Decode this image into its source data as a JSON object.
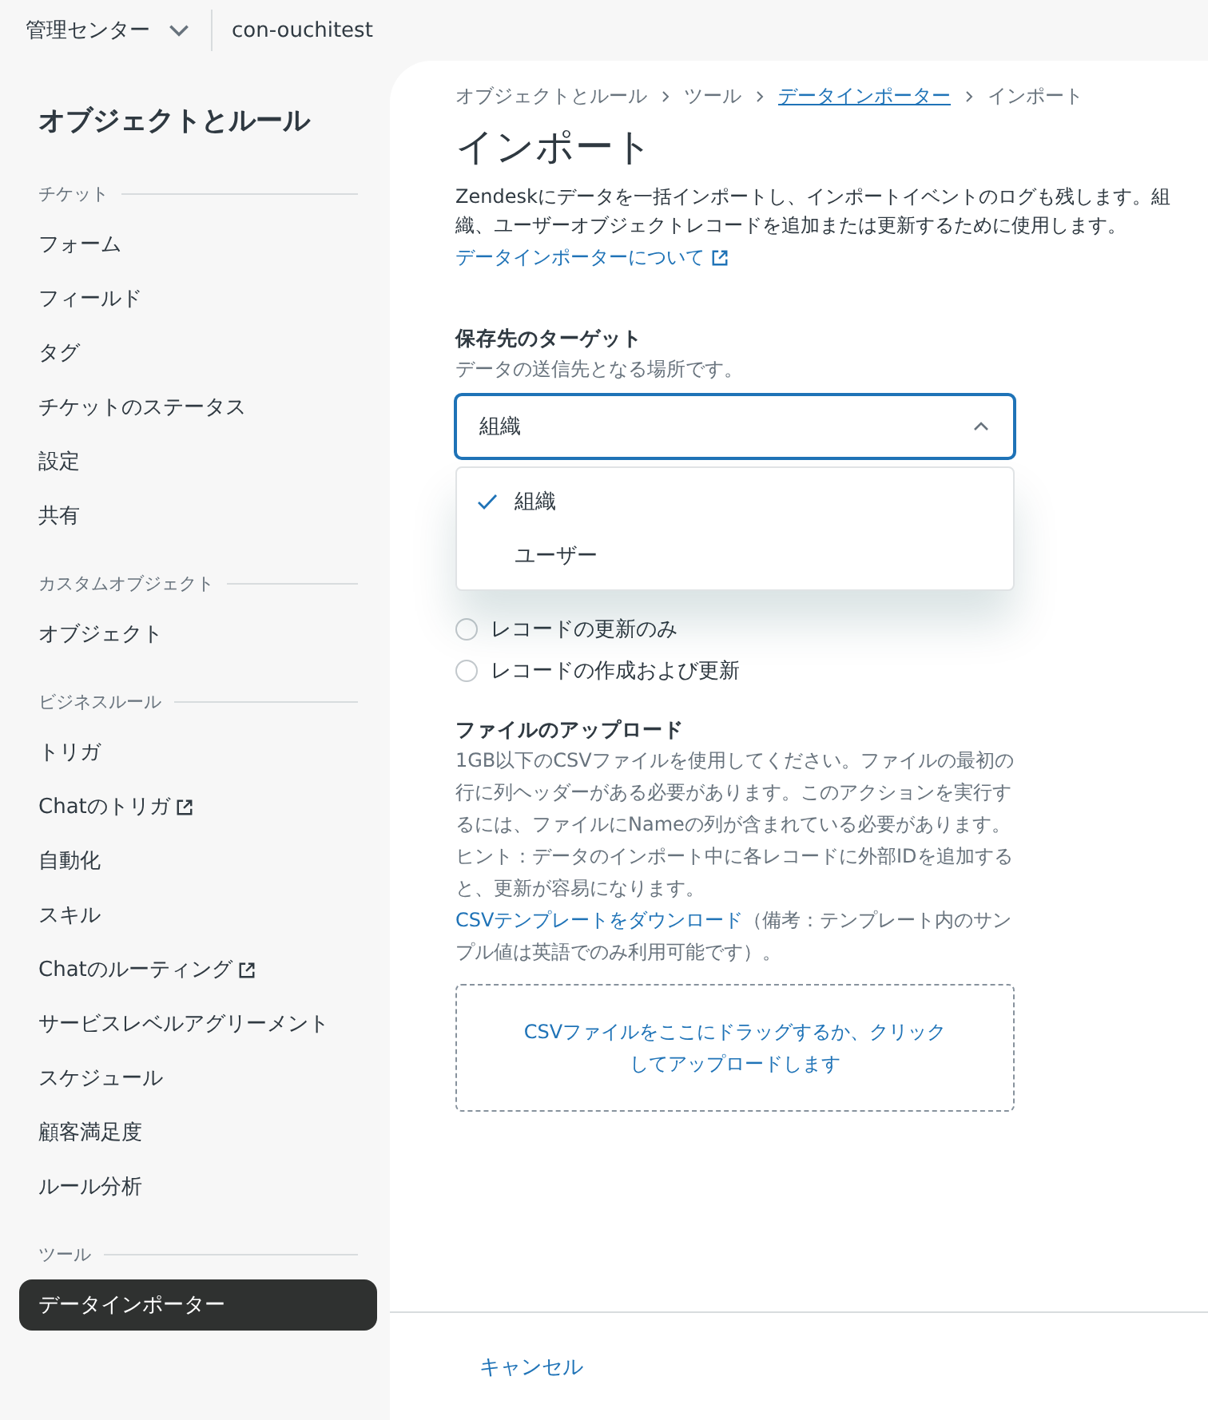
{
  "top_bar": {
    "product_menu": "管理センター",
    "account": "con-ouchitest"
  },
  "sidebar": {
    "title": "オブジェクトとルール",
    "sections": [
      {
        "heading": "チケット",
        "items": [
          {
            "label": "フォーム",
            "external": false,
            "selected": false
          },
          {
            "label": "フィールド",
            "external": false,
            "selected": false
          },
          {
            "label": "タグ",
            "external": false,
            "selected": false
          },
          {
            "label": "チケットのステータス",
            "external": false,
            "selected": false
          },
          {
            "label": "設定",
            "external": false,
            "selected": false
          },
          {
            "label": "共有",
            "external": false,
            "selected": false
          }
        ]
      },
      {
        "heading": "カスタムオブジェクト",
        "items": [
          {
            "label": "オブジェクト",
            "external": false,
            "selected": false
          }
        ]
      },
      {
        "heading": "ビジネスルール",
        "items": [
          {
            "label": "トリガ",
            "external": false,
            "selected": false
          },
          {
            "label": "Chatのトリガ",
            "external": true,
            "selected": false
          },
          {
            "label": "自動化",
            "external": false,
            "selected": false
          },
          {
            "label": "スキル",
            "external": false,
            "selected": false
          },
          {
            "label": "Chatのルーティング",
            "external": true,
            "selected": false
          },
          {
            "label": "サービスレベルアグリーメント",
            "external": false,
            "selected": false
          },
          {
            "label": "スケジュール",
            "external": false,
            "selected": false
          },
          {
            "label": "顧客満足度",
            "external": false,
            "selected": false
          },
          {
            "label": "ルール分析",
            "external": false,
            "selected": false
          }
        ]
      },
      {
        "heading": "ツール",
        "items": [
          {
            "label": "データインポーター",
            "external": false,
            "selected": true
          }
        ]
      }
    ]
  },
  "breadcrumb": [
    {
      "label": "オブジェクトとルール",
      "link": false
    },
    {
      "label": "ツール",
      "link": false
    },
    {
      "label": "データインポーター",
      "link": true
    },
    {
      "label": "インポート",
      "link": false
    }
  ],
  "page_title": "インポート",
  "description": "Zendeskにデータを一括インポートし、インポートイベントのログも残します。組織、ユーザーオブジェクトレコードを追加または更新するために使用します。",
  "about_link": "データインポーターについて",
  "target": {
    "label": "保存先のターゲット",
    "hint": "データの送信先となる場所です。",
    "value": "組織",
    "expanded": true,
    "options": [
      {
        "label": "組織",
        "selected": true
      },
      {
        "label": "ユーザー",
        "selected": false
      }
    ]
  },
  "action_options": [
    {
      "label": "レコードの更新のみ",
      "selected": false
    },
    {
      "label": "レコードの作成および更新",
      "selected": false
    }
  ],
  "upload": {
    "label": "ファイルのアップロード",
    "hint": "1GB以下のCSVファイルを使用してください。ファイルの最初の行に列ヘッダーがある必要があります。このアクションを実行するには、ファイルにNameの列が含まれている必要があります。ヒント：データのインポート中に各レコードに外部IDを追加すると、更新が容易になります。",
    "template_link": "CSVテンプレートをダウンロード",
    "template_note": "（備考：テンプレート内のサンプル値は英語でのみ利用可能です）。",
    "dropzone": "CSVファイルをここにドラッグするか、クリックしてアップロードします"
  },
  "footer": {
    "cancel": "キャンセル"
  }
}
